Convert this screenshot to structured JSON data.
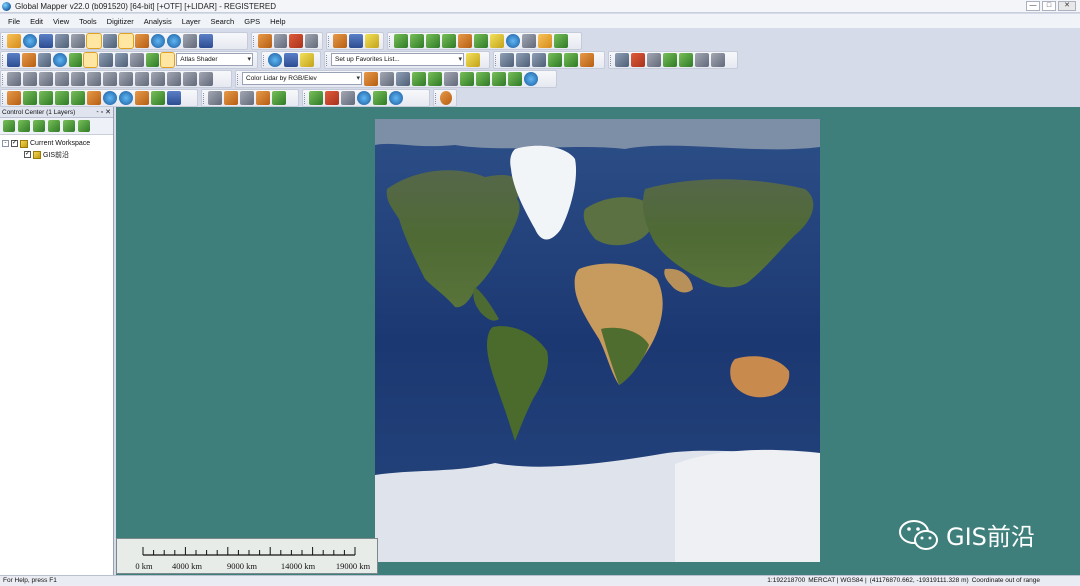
{
  "window": {
    "title": "Global Mapper v22.0 (b091520) [64-bit] [+OTF] [+LIDAR] - REGISTERED",
    "controls": [
      "—",
      "□",
      "✕"
    ]
  },
  "menu": [
    "File",
    "Edit",
    "View",
    "Tools",
    "Digitizer",
    "Analysis",
    "Layer",
    "Search",
    "GPS",
    "Help"
  ],
  "toolbars": {
    "shader_select": "Atlas Shader",
    "favorites_select": "Set up Favorites List...",
    "lidar_color_select": "Color Lidar by RGB/Elev"
  },
  "control_center": {
    "title": "Control Center (1 Layers)",
    "header_controls": "- ▫ ✕",
    "tree": [
      {
        "label": "Current Workspace",
        "expander": "-",
        "checked": true
      },
      {
        "label": "GIS前沿",
        "checked": true
      }
    ]
  },
  "scale_bar": {
    "labels": [
      "0 km",
      "4000 km",
      "9000 km",
      "14000 km",
      "19000 km"
    ]
  },
  "watermark": {
    "text": "GIS前沿",
    "icon": "wechat-icon"
  },
  "status": {
    "help": "For Help, press F1",
    "scale": "1:192218700",
    "projection": "MERCAT | WGS84 |",
    "coords": "(41176870.662, -19319111.328 m)",
    "message": "Coordinate out of range"
  },
  "colors": {
    "map_background": "#3e7f7c",
    "ocean": "#1d3a73"
  }
}
